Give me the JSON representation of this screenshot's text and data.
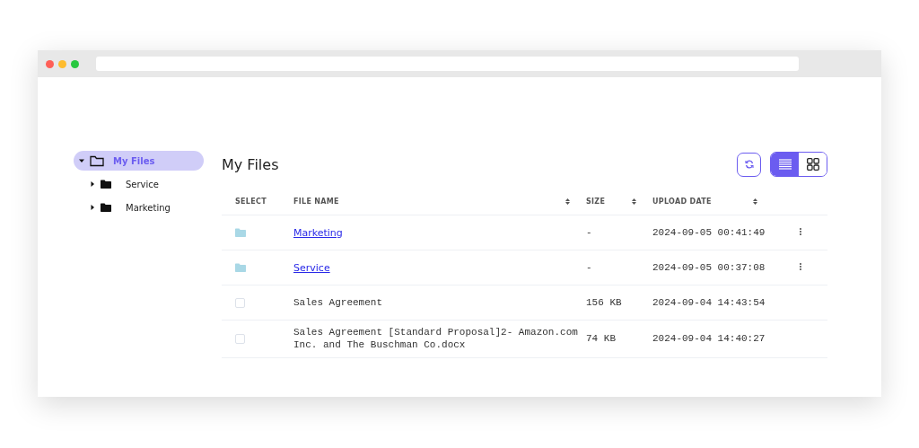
{
  "sidebar": {
    "tree": [
      {
        "label": "My Files",
        "expanded": true,
        "selected": true,
        "children": [
          {
            "label": "Service",
            "expanded": false,
            "selected": false
          },
          {
            "label": "Marketing",
            "expanded": false,
            "selected": false
          }
        ]
      }
    ]
  },
  "main": {
    "title": "My Files",
    "view_toggle": [
      {
        "kind": "list",
        "selected": true
      },
      {
        "kind": "grid",
        "selected": false
      }
    ],
    "table": {
      "columns": [
        {
          "label": "SELECT",
          "sortable": false
        },
        {
          "label": "FILE NAME",
          "sortable": true
        },
        {
          "label": "SIZE",
          "sortable": true
        },
        {
          "label": "UPLOAD DATE",
          "sortable": true
        }
      ],
      "rows": [
        {
          "kind": "folder",
          "name": "Marketing",
          "size": "-",
          "date": "2024-09-05 00:41:49"
        },
        {
          "kind": "folder",
          "name": "Service",
          "size": "-",
          "date": "2024-09-05 00:37:08"
        },
        {
          "kind": "file",
          "checked": false,
          "name": "Sales Agreement",
          "size": "156 KB",
          "date": "2024-09-04 14:43:54"
        },
        {
          "kind": "file",
          "checked": false,
          "name": "Sales Agreement [Standard Proposal]2- Amazon.com Inc. and The Buschman Co.docx",
          "size": "74 KB",
          "date": "2024-09-04 14:40:27"
        }
      ]
    }
  }
}
